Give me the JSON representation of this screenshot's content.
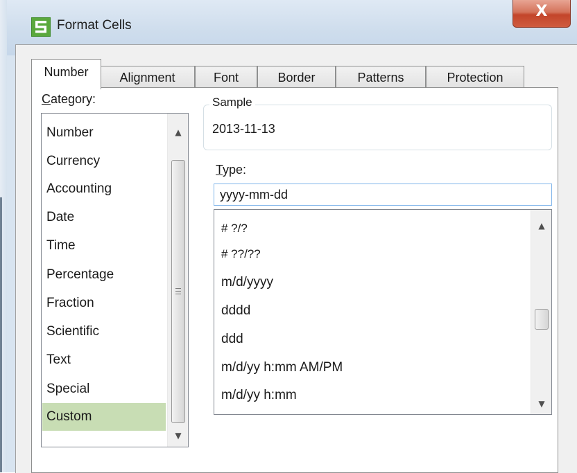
{
  "window": {
    "title": "Format Cells",
    "close_glyph": "X",
    "app_icon": "spreadsheet-app-icon",
    "accent": "#5aa83c"
  },
  "tabs": [
    {
      "label": "Number",
      "active": true
    },
    {
      "label": "Alignment",
      "active": false
    },
    {
      "label": "Font",
      "active": false
    },
    {
      "label": "Border",
      "active": false
    },
    {
      "label": "Patterns",
      "active": false
    },
    {
      "label": "Protection",
      "active": false
    }
  ],
  "category": {
    "label_first": "C",
    "label_rest": "ategory:",
    "items": [
      "Number",
      "Currency",
      "Accounting",
      "Date",
      "Time",
      "Percentage",
      "Fraction",
      "Scientific",
      "Text",
      "Special",
      "Custom"
    ],
    "selected": "Custom",
    "selected_color": "#c8ddb4"
  },
  "sample": {
    "label": "Sample",
    "value": "2013-11-13"
  },
  "type": {
    "label_first": "T",
    "label_rest": "ype:",
    "value": "yyyy-mm-dd",
    "items": [
      "# ?/?",
      "# ??/??",
      "m/d/yyyy",
      "dddd",
      "ddd",
      "m/d/yy h:mm AM/PM",
      "m/d/yy h:mm"
    ]
  },
  "icons": {
    "scroll_up": "▲",
    "scroll_down": "▼"
  }
}
